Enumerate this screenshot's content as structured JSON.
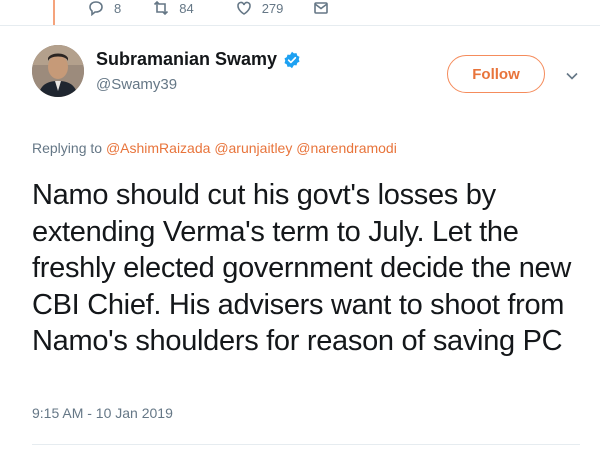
{
  "previous_tweet": {
    "reply_count": "8",
    "retweet_count": "84",
    "like_count": "279"
  },
  "tweet": {
    "author_name": "Subramanian Swamy",
    "handle": "@Swamy39",
    "follow_label": "Follow",
    "replying_prefix": "Replying to",
    "mentions": [
      "@AshimRaizada",
      "@arunjaitley",
      "@narendramodi"
    ],
    "text": "Namo should cut his govt's losses by extending Verma's term to July. Let the freshly elected government decide the new CBI Chief. His advisers want to shoot from Namo's shoulders for reason of saving PC",
    "timestamp": "9:15 AM - 10 Jan 2019"
  },
  "colors": {
    "accent": "#e8743b",
    "verified": "#1da1f2",
    "secondary_text": "#657786"
  },
  "icons": [
    "reply-icon",
    "retweet-icon",
    "like-icon",
    "message-icon",
    "verified-badge-icon",
    "chevron-down-icon"
  ]
}
